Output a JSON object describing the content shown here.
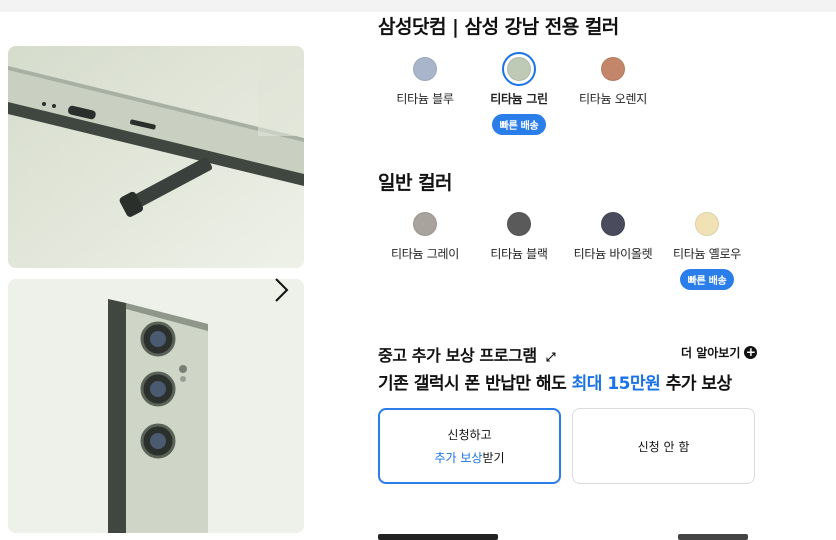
{
  "exclusive": {
    "title": "삼성닷컴 | 삼성 강남 전용 컬러",
    "colors": [
      {
        "label": "티타늄 블루",
        "color": "#a8b5cb",
        "selected": false,
        "badge": ""
      },
      {
        "label": "티타늄 그린",
        "color": "#bfcab6",
        "selected": true,
        "badge": "빠른 배송"
      },
      {
        "label": "티타늄 오렌지",
        "color": "#c4866a",
        "selected": false,
        "badge": ""
      }
    ]
  },
  "standard": {
    "title": "일반 컬러",
    "colors": [
      {
        "label": "티타늄 그레이",
        "color": "#a9a39e",
        "badge": ""
      },
      {
        "label": "티타늄 블랙",
        "color": "#5a5a5a",
        "badge": ""
      },
      {
        "label": "티타늄 바이올렛",
        "color": "#4a4c5e",
        "badge": ""
      },
      {
        "label": "티타늄 옐로우",
        "color": "#f1e2b6",
        "badge": "빠른 배송"
      }
    ]
  },
  "tradein": {
    "title": "중고 추가 보상 프로그램",
    "more": "더 알아보기",
    "sub_prefix": "기존 갤럭시 폰 반납만 해도 ",
    "sub_highlight": "최대 15만원",
    "sub_suffix": " 추가 보상",
    "apply_line1": "신청하고",
    "apply_line2_blue": "추가 보상",
    "apply_line2_rest": "받기",
    "decline": "신청 안 함"
  },
  "accent_color": "#1a73e8",
  "icons": [
    "chevron-right-icon",
    "arrow-icon",
    "plus-circle-icon"
  ]
}
